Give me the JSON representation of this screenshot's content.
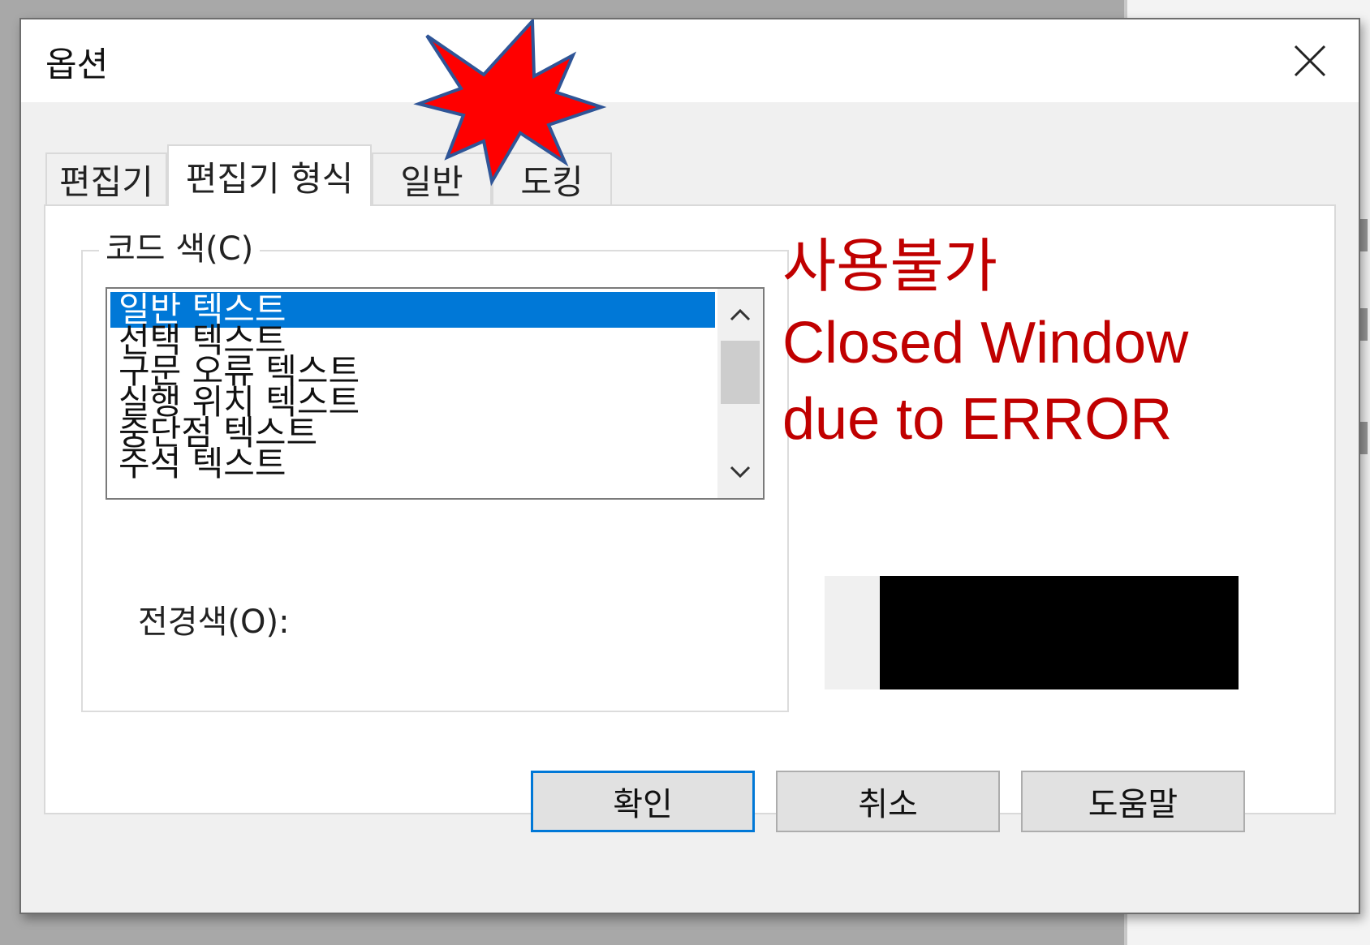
{
  "dialog": {
    "title": "옵션"
  },
  "tabs": [
    {
      "label": "편집기"
    },
    {
      "label": "편집기 형식",
      "active": true
    },
    {
      "label": "일반"
    },
    {
      "label": "도킹"
    }
  ],
  "code_color": {
    "group_label": "코드 색(C)",
    "items": [
      "일반 텍스트",
      "선택 텍스트",
      "구문 오류 텍스트",
      "실행 위치 텍스트",
      "중단점 텍스트",
      "주석 텍스트"
    ],
    "selected_index": 0
  },
  "foreground": {
    "label": "전경색(O):",
    "color": "#000000"
  },
  "annotation": {
    "lines": [
      "사용불가",
      "Closed Window",
      "due to ERROR"
    ],
    "color": "#c00000",
    "burst_fill": "#ff0000",
    "burst_stroke": "#2f5597"
  },
  "buttons": {
    "ok": "확인",
    "cancel": "취소",
    "help": "도움말"
  },
  "colors": {
    "selection": "#0078d7",
    "dialog_bg": "#f0f0f0"
  }
}
